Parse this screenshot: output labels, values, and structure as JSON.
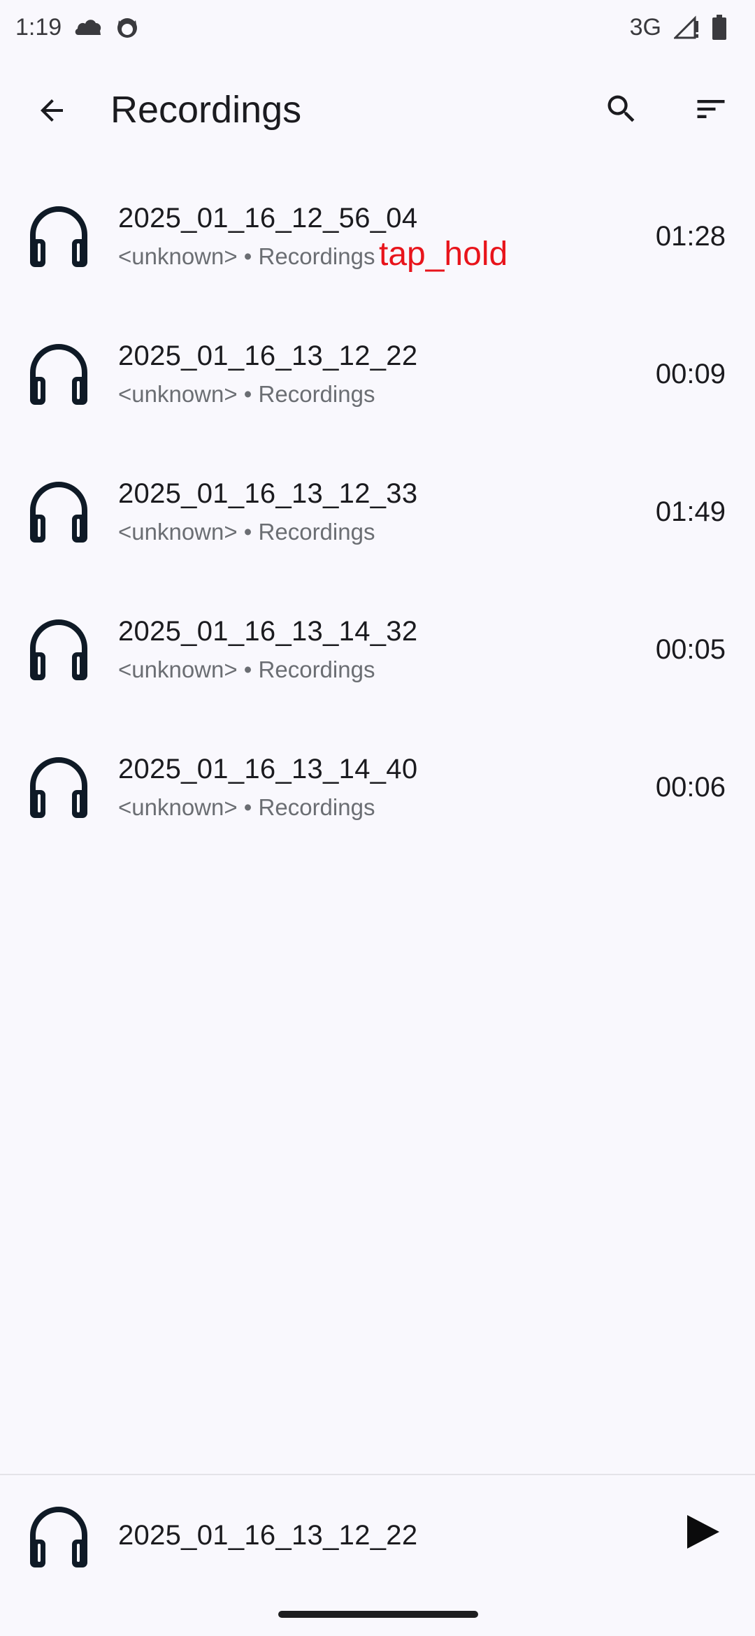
{
  "status_bar": {
    "time": "1:19",
    "network": "3G",
    "icons": [
      "cloud-notification-icon",
      "cat-notification-icon",
      "signal-icon",
      "battery-icon"
    ]
  },
  "app_bar": {
    "title": "Recordings",
    "icons": [
      "arrow-back-icon",
      "search-icon",
      "sort-icon"
    ]
  },
  "recordings": [
    {
      "title": "2025_01_16_12_56_04",
      "subtitle": "<unknown> • Recordings",
      "duration": "01:28"
    },
    {
      "title": "2025_01_16_13_12_22",
      "subtitle": "<unknown> • Recordings",
      "duration": "00:09"
    },
    {
      "title": "2025_01_16_13_12_33",
      "subtitle": "<unknown> • Recordings",
      "duration": "01:49"
    },
    {
      "title": "2025_01_16_13_14_32",
      "subtitle": "<unknown> • Recordings",
      "duration": "00:05"
    },
    {
      "title": "2025_01_16_13_14_40",
      "subtitle": "<unknown> • Recordings",
      "duration": "00:06"
    }
  ],
  "overlay": {
    "label": "tap_hold",
    "color": "#e8141b"
  },
  "player": {
    "title": "2025_01_16_13_12_22",
    "icons": [
      "headphones-icon",
      "play-icon"
    ]
  },
  "colors": {
    "background": "#f9f8fd",
    "text_primary": "#1b1b1f",
    "text_secondary": "#6b6e73",
    "icon": "#0f1a26"
  }
}
